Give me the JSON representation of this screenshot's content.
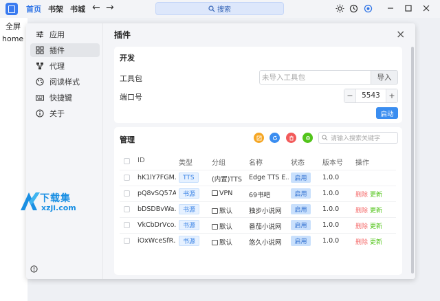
{
  "topbar": {
    "tabs": [
      "首页",
      "书架",
      "书城"
    ],
    "search_label": "搜索"
  },
  "background": {
    "tab_label": "全屏",
    "home_text": "home"
  },
  "sidebar": {
    "items": [
      {
        "label": "应用",
        "icon": "sliders-icon"
      },
      {
        "label": "插件",
        "icon": "grid-icon"
      },
      {
        "label": "代理",
        "icon": "network-icon"
      },
      {
        "label": "阅读样式",
        "icon": "palette-icon"
      },
      {
        "label": "快捷键",
        "icon": "keyboard-icon"
      },
      {
        "label": "关于",
        "icon": "info-icon"
      }
    ],
    "active_index": 1
  },
  "dialog": {
    "title": "插件"
  },
  "dev": {
    "title": "开发",
    "toolkit_label": "工具包",
    "toolkit_placeholder": "未导入工具包",
    "import_label": "导入",
    "port_label": "端口号",
    "port_value": "5543",
    "minus": "−",
    "plus": "+",
    "start_label": "启动"
  },
  "manage": {
    "title": "管理",
    "search_placeholder": "请输入搜索关键字",
    "action_colors": [
      "#f5a623",
      "#3a8df0",
      "#f25a5a",
      "#52c41a"
    ],
    "columns": [
      "ID",
      "类型",
      "分组",
      "名称",
      "状态",
      "版本号",
      "操作"
    ],
    "rows": [
      {
        "id": "hK1lY7FGM...",
        "type": "TTS",
        "group": "(内置)TTS",
        "group_icon": false,
        "name": "Edge TTS E...",
        "status": "启用",
        "version": "1.0.0",
        "del": "",
        "upd": ""
      },
      {
        "id": "pQ8vSQ57A...",
        "type": "书源",
        "group": "VPN",
        "group_icon": true,
        "name": "69书吧",
        "status": "启用",
        "version": "1.0.0",
        "del": "删除",
        "upd": "更新"
      },
      {
        "id": "bDSDBvWa...",
        "type": "书源",
        "group": "默认",
        "group_icon": true,
        "name": "独步小说网",
        "status": "启用",
        "version": "1.0.0",
        "del": "删除",
        "upd": "更新"
      },
      {
        "id": "VkCbDrVco...",
        "type": "书源",
        "group": "默认",
        "group_icon": true,
        "name": "番茄小说网",
        "status": "启用",
        "version": "1.0.0",
        "del": "删除",
        "upd": "更新"
      },
      {
        "id": "iOxWceSfR...",
        "type": "书源",
        "group": "默认",
        "group_icon": true,
        "name": "悠久小说网",
        "status": "启用",
        "version": "1.0.0",
        "del": "删除",
        "upd": "更新"
      }
    ]
  },
  "watermark": {
    "line1": "下载集",
    "line2": "xzji.com"
  },
  "colors": {
    "accent": "#2f74e6",
    "delete": "#f56c6c",
    "update": "#52c41a"
  }
}
